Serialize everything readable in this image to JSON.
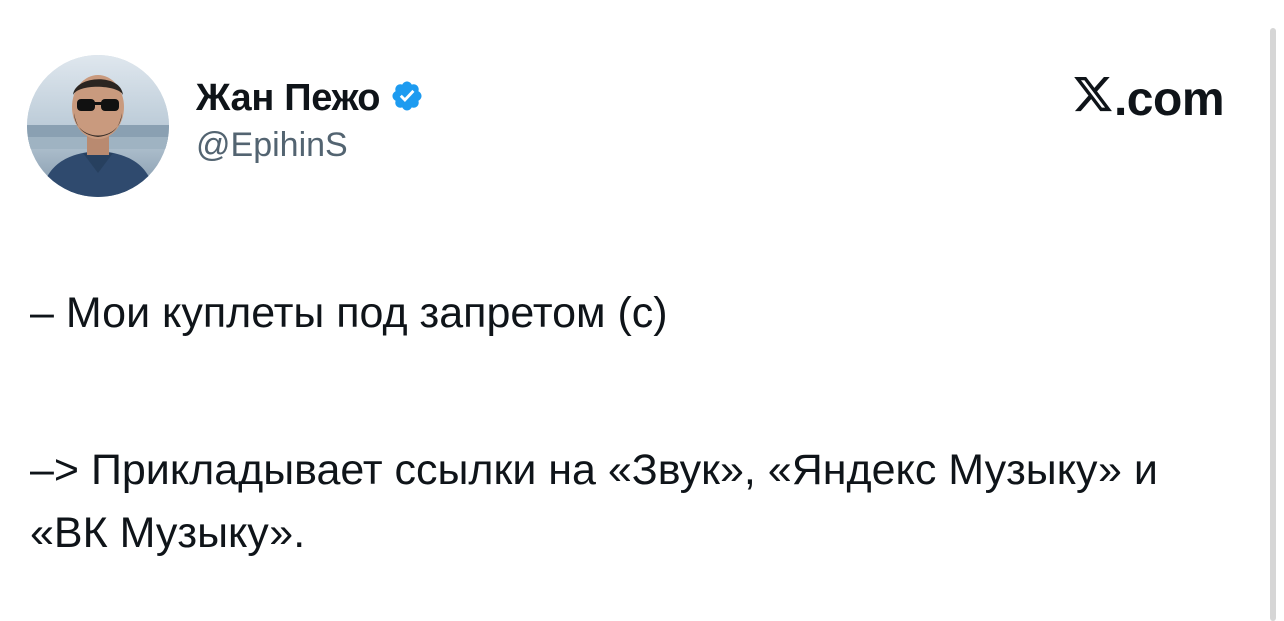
{
  "author": {
    "display_name": "Жан Пежо",
    "handle": "@EpihinS",
    "verified": true
  },
  "brand": {
    "suffix": ".com"
  },
  "tweet": {
    "line1": "– Мои куплеты под запретом (с)",
    "line2": "–> Прикладывает ссылки на «Звук», «Яндекс Музыку» и «ВК Музыку»."
  },
  "icons": {
    "verified": "verified-badge-icon",
    "brand": "x-logo-icon"
  },
  "colors": {
    "verified_blue": "#1d9bf0",
    "handle_gray": "#536471",
    "text": "#0f1419"
  }
}
